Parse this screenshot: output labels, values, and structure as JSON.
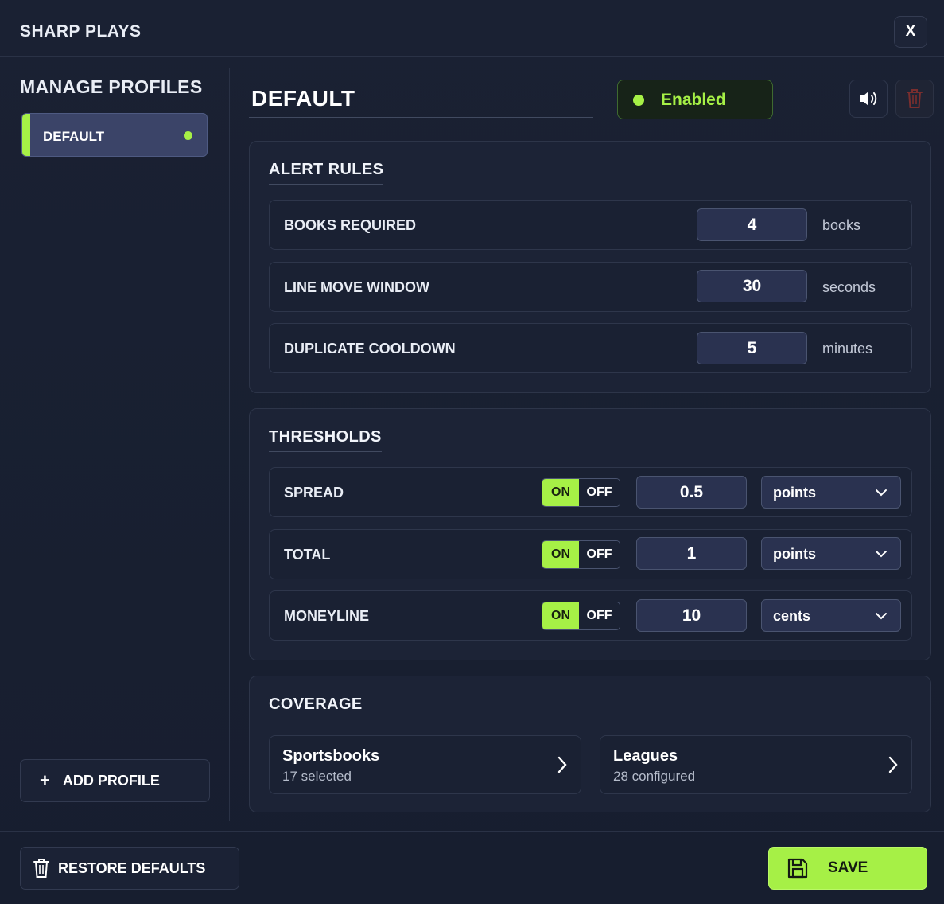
{
  "app": {
    "title": "SHARP PLAYS",
    "close_label": "X"
  },
  "sidebar": {
    "title": "MANAGE PROFILES",
    "profiles": [
      {
        "label": "DEFAULT",
        "active": true
      }
    ],
    "add_label": "ADD PROFILE",
    "add_icon": "+"
  },
  "profile": {
    "name": "DEFAULT",
    "status_label": "Enabled",
    "status_color": "#a6f046"
  },
  "alert_rules": {
    "title": "ALERT RULES",
    "rows": [
      {
        "label": "BOOKS REQUIRED",
        "value": "4",
        "unit": "books"
      },
      {
        "label": "LINE MOVE WINDOW",
        "value": "30",
        "unit": "seconds"
      },
      {
        "label": "DUPLICATE COOLDOWN",
        "value": "5",
        "unit": "minutes"
      }
    ]
  },
  "thresholds": {
    "title": "THRESHOLDS",
    "on_label": "ON",
    "off_label": "OFF",
    "rows": [
      {
        "label": "SPREAD",
        "state": "ON",
        "value": "0.5",
        "unit": "points"
      },
      {
        "label": "TOTAL",
        "state": "ON",
        "value": "1",
        "unit": "points"
      },
      {
        "label": "MONEYLINE",
        "state": "ON",
        "value": "10",
        "unit": "cents"
      }
    ]
  },
  "coverage": {
    "title": "COVERAGE",
    "cards": [
      {
        "title": "Sportsbooks",
        "subtitle": "17 selected"
      },
      {
        "title": "Leagues",
        "subtitle": "28 configured"
      }
    ]
  },
  "footer": {
    "restore_label": "RESTORE DEFAULTS",
    "save_label": "SAVE"
  },
  "colors": {
    "accent": "#a6f046",
    "background": "#1a2133",
    "danger": "#c0392b"
  }
}
